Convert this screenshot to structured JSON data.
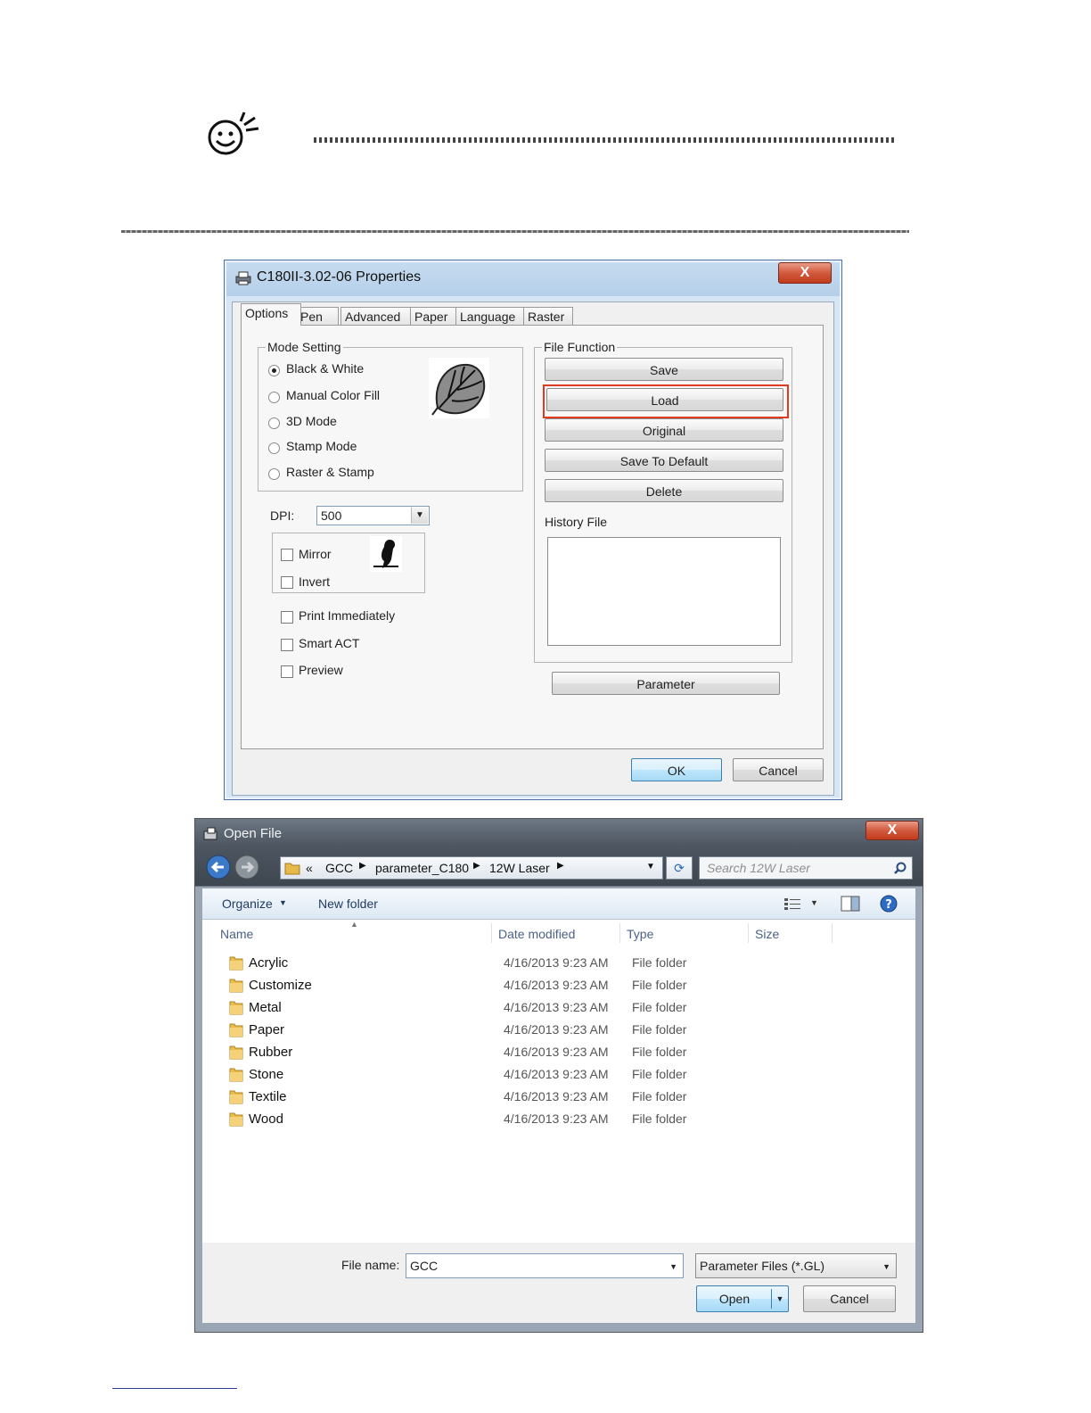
{
  "props_dialog": {
    "title": "C180II-3.02-06 Properties",
    "close_label": "X",
    "tabs": [
      "Options",
      "Pen",
      "Advanced",
      "Paper",
      "Language",
      "Raster"
    ],
    "mode_setting": {
      "legend": "Mode Setting",
      "options": [
        "Black & White",
        "Manual Color Fill",
        "3D Mode",
        "Stamp Mode",
        "Raster & Stamp"
      ],
      "selected": "Black & White"
    },
    "dpi_label": "DPI:",
    "dpi_value": "500",
    "mirror_label": "Mirror",
    "invert_label": "Invert",
    "print_immediately_label": "Print Immediately",
    "smart_act_label": "Smart ACT",
    "preview_label": "Preview",
    "file_function": {
      "legend": "File Function",
      "buttons": [
        "Save",
        "Load",
        "Original",
        "Save To Default",
        "Delete"
      ],
      "highlighted": "Load",
      "history_label": "History File"
    },
    "parameter_label": "Parameter",
    "ok_label": "OK",
    "cancel_label": "Cancel",
    "highlight_color": "#e03a20"
  },
  "open_file_dialog": {
    "title": "Open File",
    "close_label": "X",
    "breadcrumb": [
      "«",
      "GCC",
      "parameter_C180",
      "12W Laser"
    ],
    "search_placeholder": "Search 12W Laser",
    "organize_label": "Organize",
    "new_folder_label": "New folder",
    "columns": [
      "Name",
      "Date modified",
      "Type",
      "Size"
    ],
    "rows": [
      {
        "name": "Acrylic",
        "date": "4/16/2013 9:23 AM",
        "type": "File folder"
      },
      {
        "name": "Customize",
        "date": "4/16/2013 9:23 AM",
        "type": "File folder"
      },
      {
        "name": "Metal",
        "date": "4/16/2013 9:23 AM",
        "type": "File folder"
      },
      {
        "name": "Paper",
        "date": "4/16/2013 9:23 AM",
        "type": "File folder"
      },
      {
        "name": "Rubber",
        "date": "4/16/2013 9:23 AM",
        "type": "File folder"
      },
      {
        "name": "Stone",
        "date": "4/16/2013 9:23 AM",
        "type": "File folder"
      },
      {
        "name": "Textile",
        "date": "4/16/2013 9:23 AM",
        "type": "File folder"
      },
      {
        "name": "Wood",
        "date": "4/16/2013 9:23 AM",
        "type": "File folder"
      }
    ],
    "file_name_label": "File name:",
    "file_name_value": "GCC",
    "file_type_value": "Parameter Files (*.GL)",
    "open_label": "Open",
    "cancel_label": "Cancel"
  }
}
